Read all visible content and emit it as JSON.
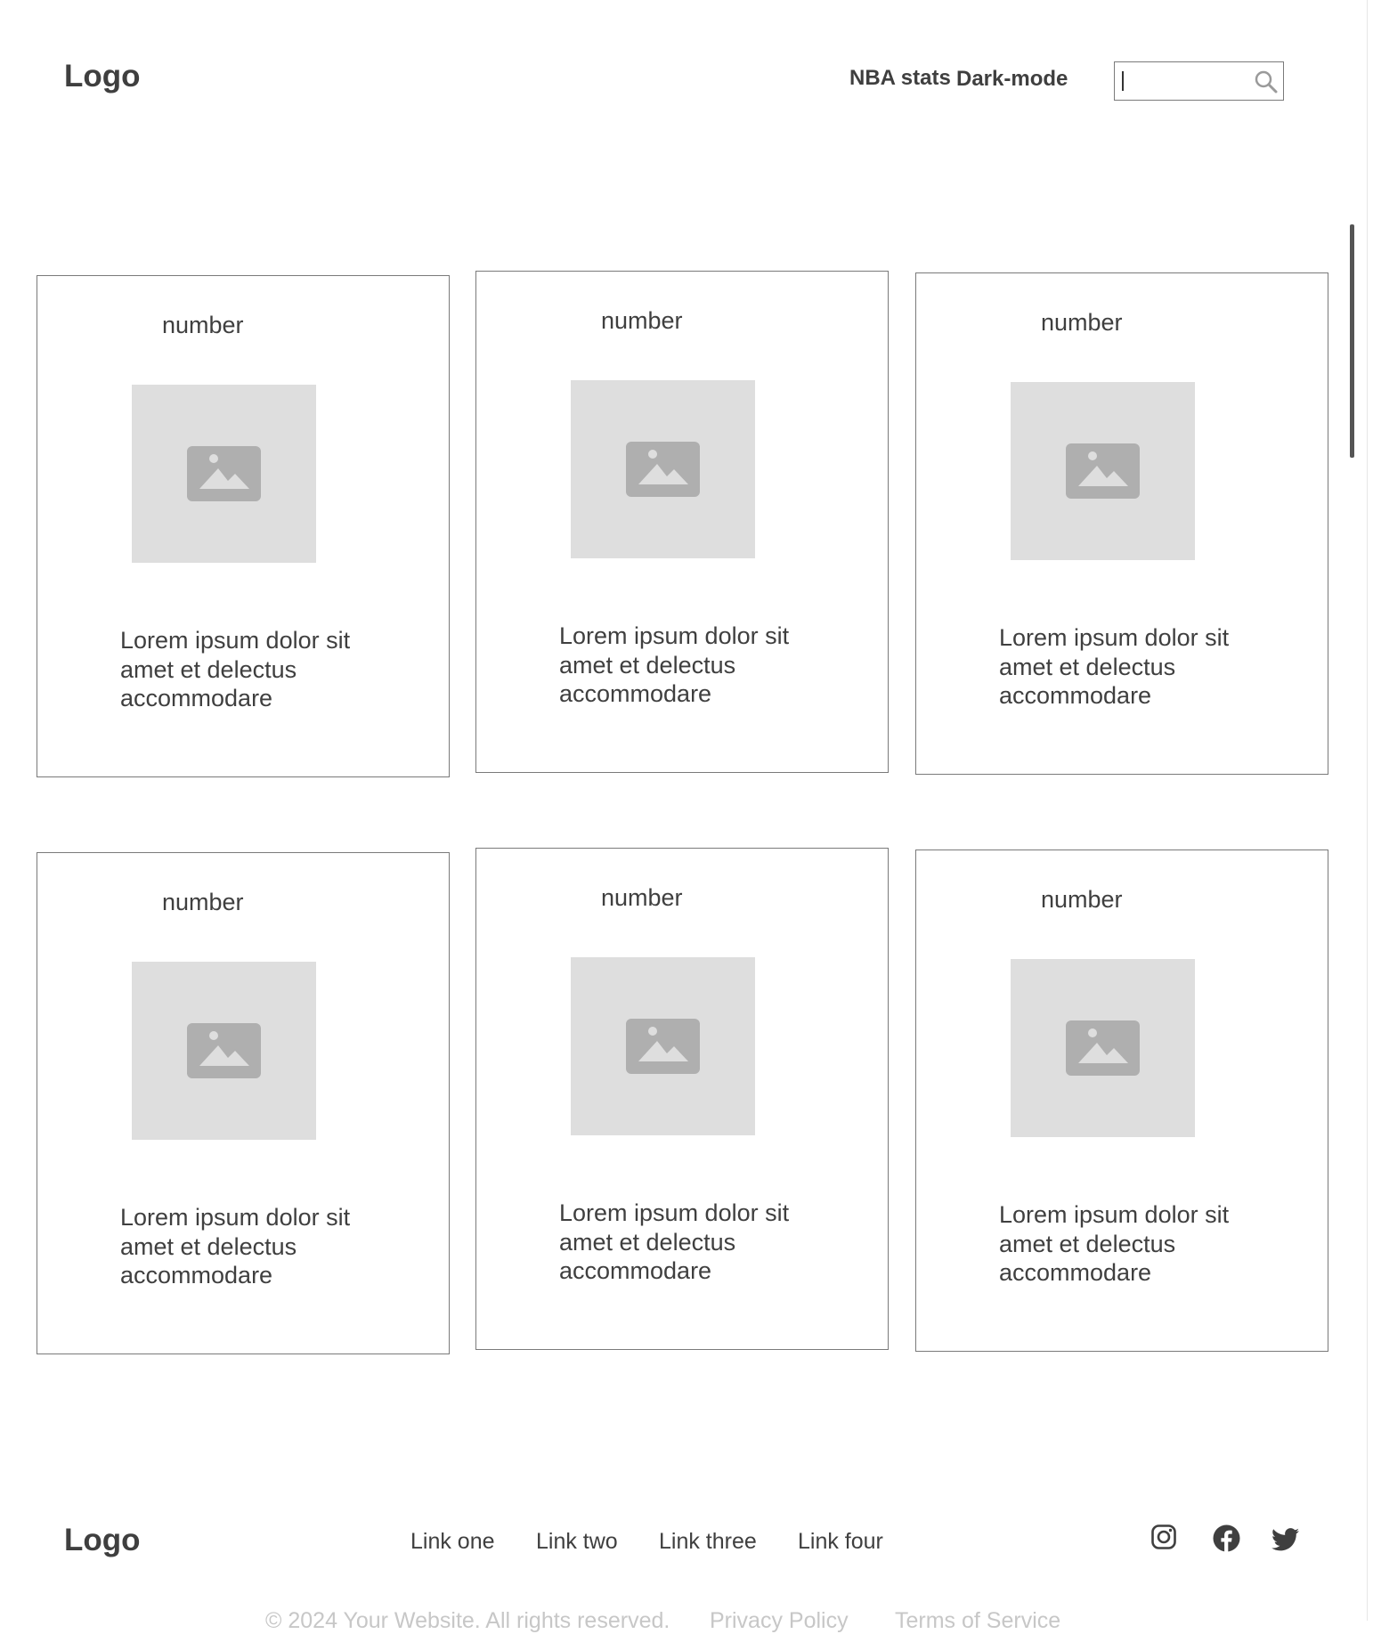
{
  "header": {
    "logo": "Logo",
    "nav": [
      "NBA stats",
      "Dark-mode"
    ],
    "search": {
      "value": "",
      "icon": "search-icon"
    }
  },
  "cards": [
    {
      "number": "number",
      "image": "image-placeholder-icon",
      "text": "Lorem ipsum dolor sit amet et delectus accommodare"
    },
    {
      "number": "number",
      "image": "image-placeholder-icon",
      "text": "Lorem ipsum dolor sit amet et delectus accommodare"
    },
    {
      "number": "number",
      "image": "image-placeholder-icon",
      "text": "Lorem ipsum dolor sit amet et delectus accommodare"
    },
    {
      "number": "number",
      "image": "image-placeholder-icon",
      "text": "Lorem ipsum dolor sit amet et delectus accommodare"
    },
    {
      "number": "number",
      "image": "image-placeholder-icon",
      "text": "Lorem ipsum dolor sit amet et delectus accommodare"
    },
    {
      "number": "number",
      "image": "image-placeholder-icon",
      "text": "Lorem ipsum dolor sit amet et delectus accommodare"
    }
  ],
  "footer": {
    "logo": "Logo",
    "links": [
      "Link one",
      "Link two",
      "Link three",
      "Link four"
    ],
    "social": [
      "instagram-icon",
      "facebook-icon",
      "twitter-icon"
    ],
    "copyright": "© 2024 Your Website. All rights reserved.",
    "privacy": "Privacy Policy",
    "terms": "Terms of Service"
  },
  "colors": {
    "text": "#3f3f3f",
    "placeholder": "#dedede",
    "border": "#7a7a7a",
    "muted": "#c7c7c7"
  }
}
